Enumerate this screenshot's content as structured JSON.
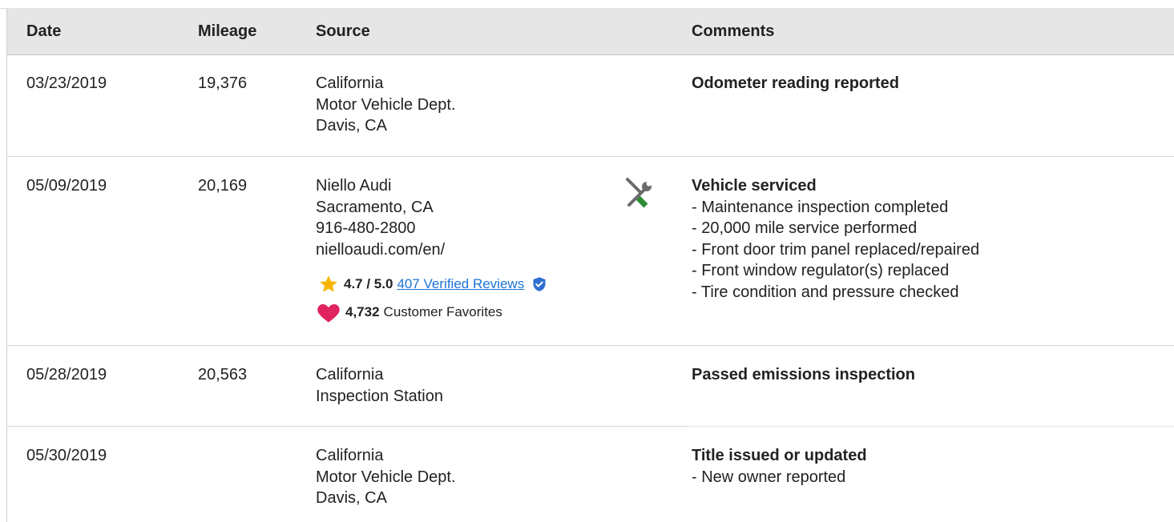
{
  "columns": {
    "date": "Date",
    "mileage": "Mileage",
    "source": "Source",
    "comments": "Comments"
  },
  "records": [
    {
      "date": "03/23/2019",
      "mileage": "19,376",
      "source": [
        "California",
        "Motor Vehicle Dept.",
        "Davis, CA"
      ],
      "comment_title": "Odometer reading reported",
      "comment_items": []
    },
    {
      "date": "05/09/2019",
      "mileage": "20,169",
      "source": [
        "Niello Audi",
        "Sacramento, CA",
        "916-480-2800",
        "nielloaudi.com/en/"
      ],
      "rating": "4.7 / 5.0",
      "reviews_link": "407 Verified Reviews",
      "favorites_count": "4,732",
      "favorites_label": "Customer Favorites",
      "icon": "service-tools-icon",
      "comment_title": "Vehicle serviced",
      "comment_items": [
        "- Maintenance inspection completed",
        "- 20,000 mile service performed",
        "- Front door trim panel replaced/repaired",
        "- Front window regulator(s) replaced",
        "- Tire condition and pressure checked"
      ]
    },
    {
      "date": "05/28/2019",
      "mileage": "20,563",
      "source": [
        "California",
        "Inspection Station"
      ],
      "comment_title": "Passed emissions inspection",
      "comment_items": []
    },
    {
      "date": "05/30/2019",
      "mileage": "",
      "source": [
        "California",
        "Motor Vehicle Dept.",
        "Davis, CA"
      ],
      "comment_title": "Title issued or updated",
      "comment_items": [
        "- New owner reported"
      ]
    }
  ],
  "colors": {
    "header_bg": "#e6e6e6",
    "link": "#1a73d6",
    "star": "#f7b500",
    "heart": "#e0245e",
    "verified": "#2f6fd1",
    "wrench_green": "#2e8b3a",
    "tool_gray": "#6b6b6b"
  }
}
